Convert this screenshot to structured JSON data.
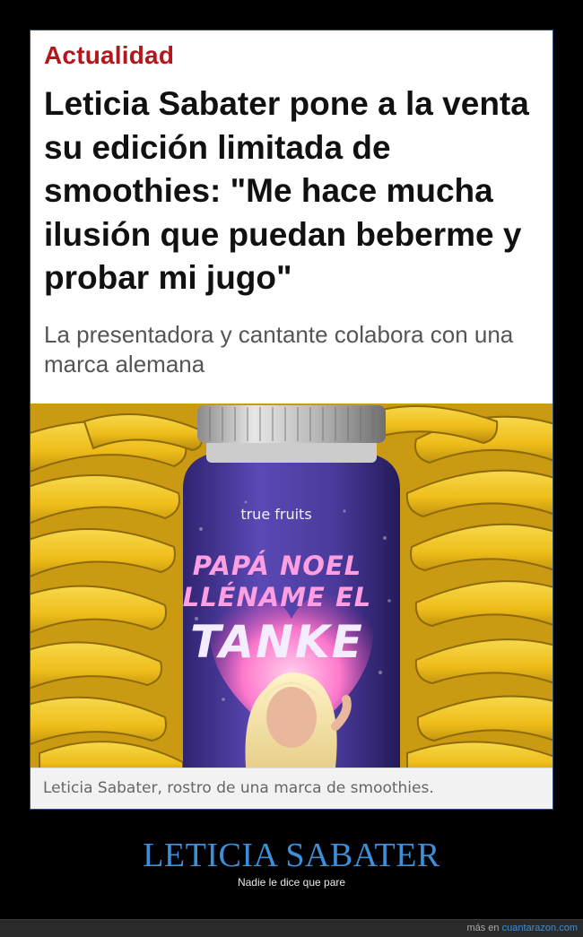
{
  "article": {
    "kicker": "Actualidad",
    "headline": "Leticia Sabater pone a la venta su edición limitada de smoothies: \"Me hace mucha ilusión que puedan beberme y probar mi jugo\"",
    "subhead": "La presentadora y cantante colabora con una marca alemana",
    "caption": "Leticia Sabater, rostro de una marca de smoothies."
  },
  "bottle": {
    "brand": "true fruits",
    "label_line1": "PAPÁ NOEL",
    "label_line2": "LLÉNAME EL",
    "label_line3": "TANKE"
  },
  "meme": {
    "title": "LETICIA SABATER",
    "subtitle": "Nadie le dice que pare"
  },
  "footer": {
    "prefix": "más en ",
    "site": "cuantarazon.com"
  },
  "colors": {
    "kicker_red": "#b3161c",
    "meme_title_blue": "#3d8fd6",
    "banana_yellow": "#f2c420",
    "bottle_purple": "#4a3a9a",
    "heart_pink": "#ff6ec7"
  }
}
